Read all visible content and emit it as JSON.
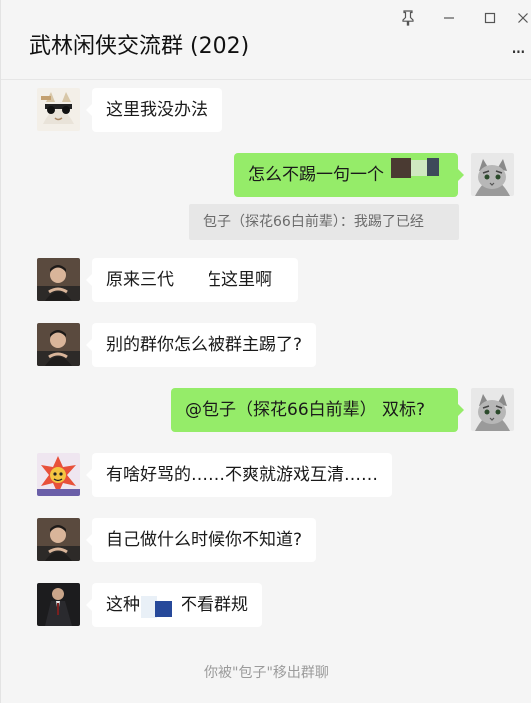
{
  "window": {
    "title": "武林闲侠交流群 (202)",
    "pin_icon": "pin-icon",
    "minimize_icon": "minimize-icon",
    "maximize_icon": "maximize-icon",
    "close_icon": "close-icon",
    "more_icon": "more-icon",
    "more_glyph": "···",
    "pin_glyph": "⚲",
    "min_glyph": "—",
    "max_glyph": "☐",
    "close_glyph": "✕"
  },
  "colors": {
    "incoming_bubble": "#ffffff",
    "outgoing_bubble": "#95ec69",
    "background": "#f5f5f5"
  },
  "messages": [
    {
      "direction": "in",
      "text": "这里我没办法"
    },
    {
      "direction": "out",
      "text": "怎么不踢一句一个"
    },
    {
      "direction": "in",
      "text": "原来三代",
      "text_tail": "在这里啊"
    },
    {
      "direction": "in",
      "text": "别的群你怎么被群主踢了?"
    },
    {
      "direction": "out",
      "text": "@包子（探花66白前辈） 双标?"
    },
    {
      "direction": "in",
      "text": "有啥好骂的……不爽就游戏互清……"
    },
    {
      "direction": "in",
      "text": "自己做什么时候你不知道?"
    },
    {
      "direction": "in",
      "text": "这种",
      "text_tail": "不看群规"
    }
  ],
  "quote": {
    "text": "包子（探花66白前辈）：我踢了已经"
  },
  "system_notice": "你被\"包子\"移出群聊"
}
